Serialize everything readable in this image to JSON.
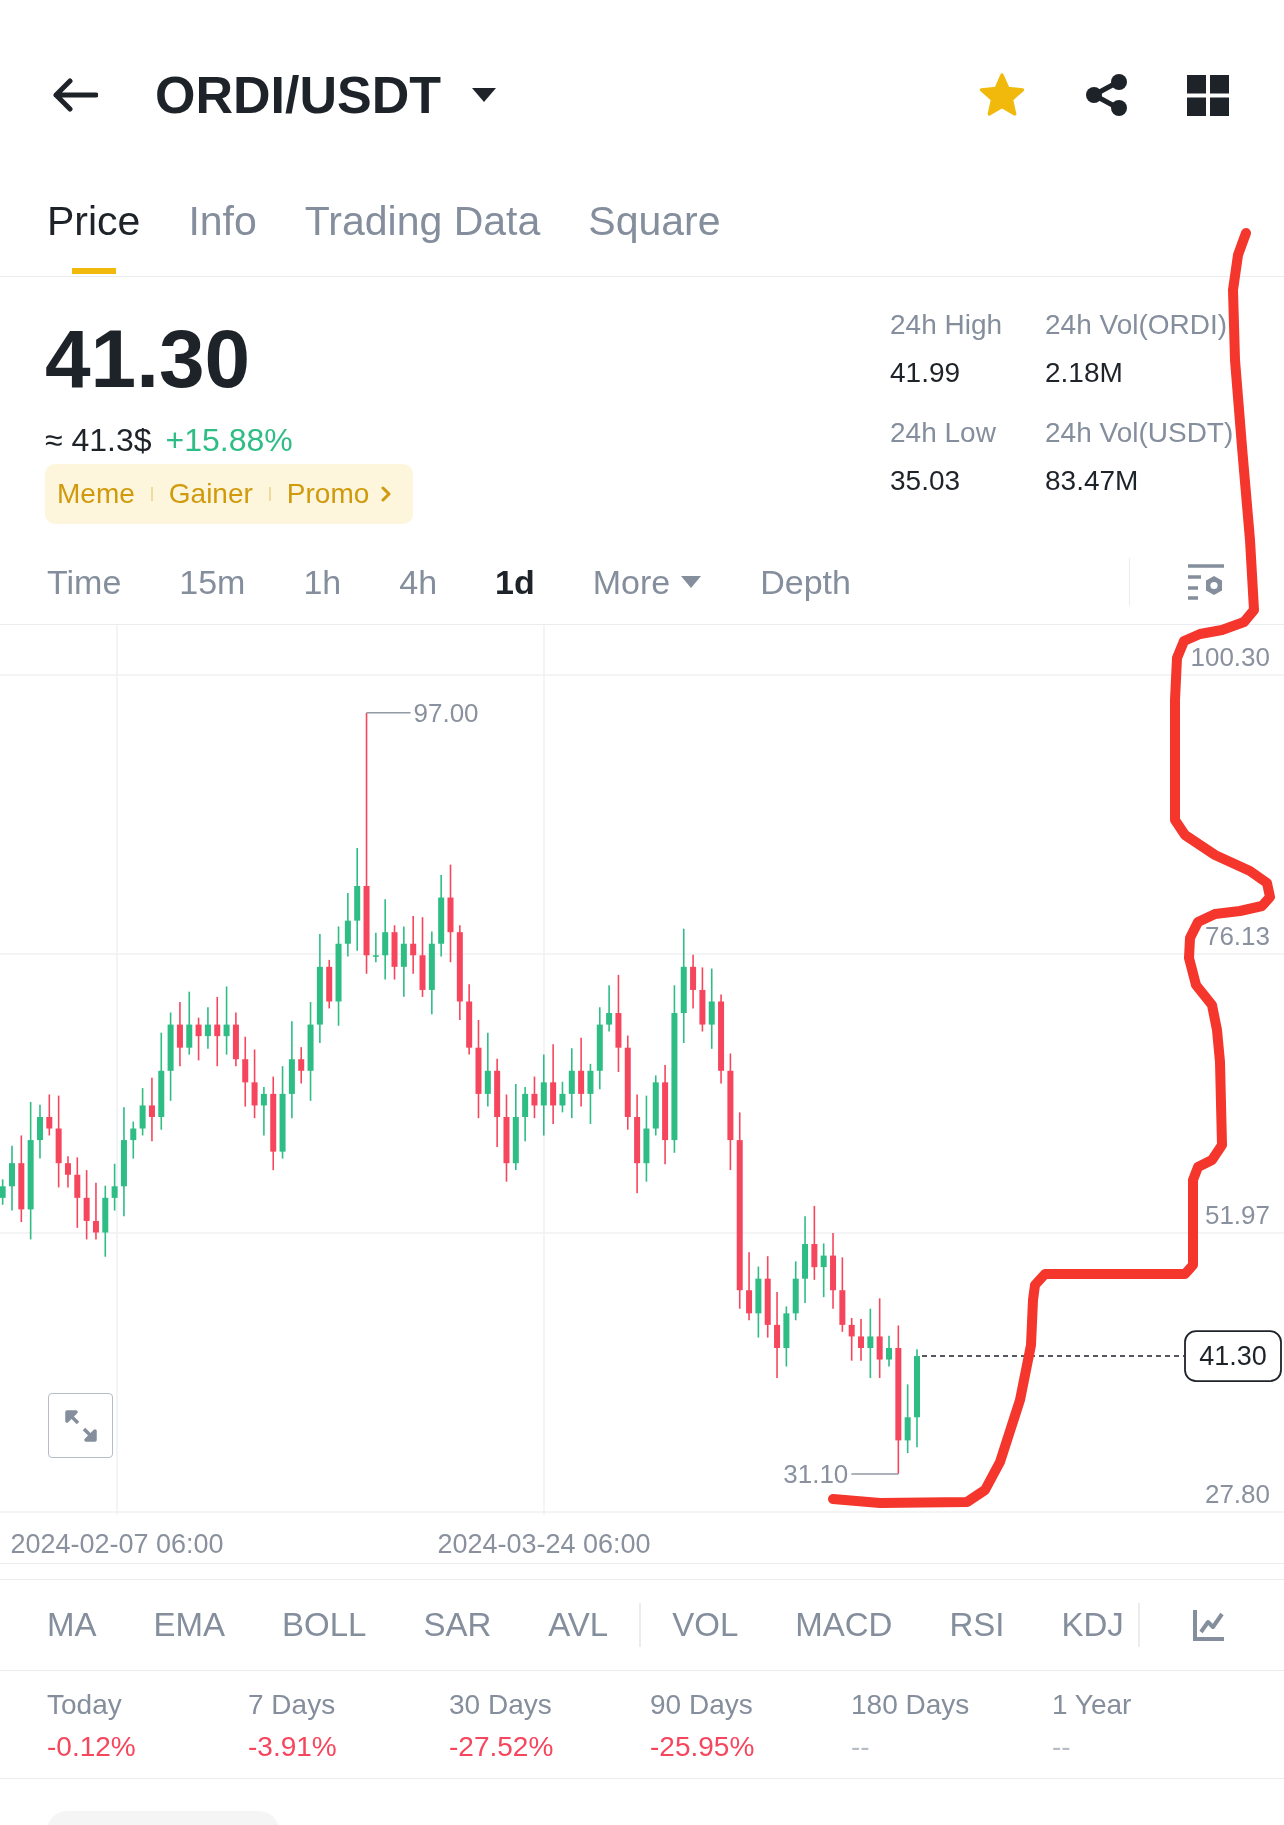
{
  "header": {
    "title": "ORDI/USDT",
    "favorite": true
  },
  "tabs": [
    {
      "label": "Price",
      "selected": true
    },
    {
      "label": "Info",
      "selected": false
    },
    {
      "label": "Trading Data",
      "selected": false
    },
    {
      "label": "Square",
      "selected": false
    }
  ],
  "price": {
    "last": "41.30",
    "approx": "≈ 41.3$",
    "change": {
      "text": "+15.88%",
      "color": "#2ebd85"
    }
  },
  "tags": [
    "Meme",
    "Gainer",
    "Promo"
  ],
  "stats": [
    {
      "label": "24h High",
      "value": "41.99"
    },
    {
      "label": "24h Vol(ORDI)",
      "value": "2.18M"
    },
    {
      "label": "24h Low",
      "value": "35.03"
    },
    {
      "label": "24h Vol(USDT)",
      "value": "83.47M"
    }
  ],
  "intervals": [
    {
      "label": "Time",
      "kind": "option",
      "selected": false
    },
    {
      "label": "15m",
      "kind": "option",
      "selected": false
    },
    {
      "label": "1h",
      "kind": "option",
      "selected": false
    },
    {
      "label": "4h",
      "kind": "option",
      "selected": false
    },
    {
      "label": "1d",
      "kind": "option",
      "selected": true
    },
    {
      "label": "More",
      "kind": "menu",
      "selected": false
    },
    {
      "label": "Depth",
      "kind": "option",
      "selected": false
    }
  ],
  "chart": {
    "y_labels": [
      "100.30",
      "76.13",
      "51.97",
      "27.80"
    ],
    "x_labels": [
      "2024-02-07 06:00",
      "2024-03-24 06:00"
    ],
    "high_label": "97.00",
    "low_label": "31.10",
    "last_price": "41.30"
  },
  "indicators": {
    "main": [
      "MA",
      "EMA",
      "BOLL",
      "SAR",
      "AVL"
    ],
    "sub": [
      "VOL",
      "MACD",
      "RSI",
      "KDJ"
    ]
  },
  "performance": [
    {
      "label": "Today",
      "value": "-0.12%",
      "color": "#f6465d"
    },
    {
      "label": "7 Days",
      "value": "-3.91%",
      "color": "#f6465d"
    },
    {
      "label": "30 Days",
      "value": "-27.52%",
      "color": "#f6465d"
    },
    {
      "label": "90 Days",
      "value": "-25.95%",
      "color": "#f6465d"
    },
    {
      "label": "180 Days",
      "value": "--",
      "color": "#b7bdc6"
    },
    {
      "label": "1 Year",
      "value": "--",
      "color": "#b7bdc6"
    }
  ]
}
